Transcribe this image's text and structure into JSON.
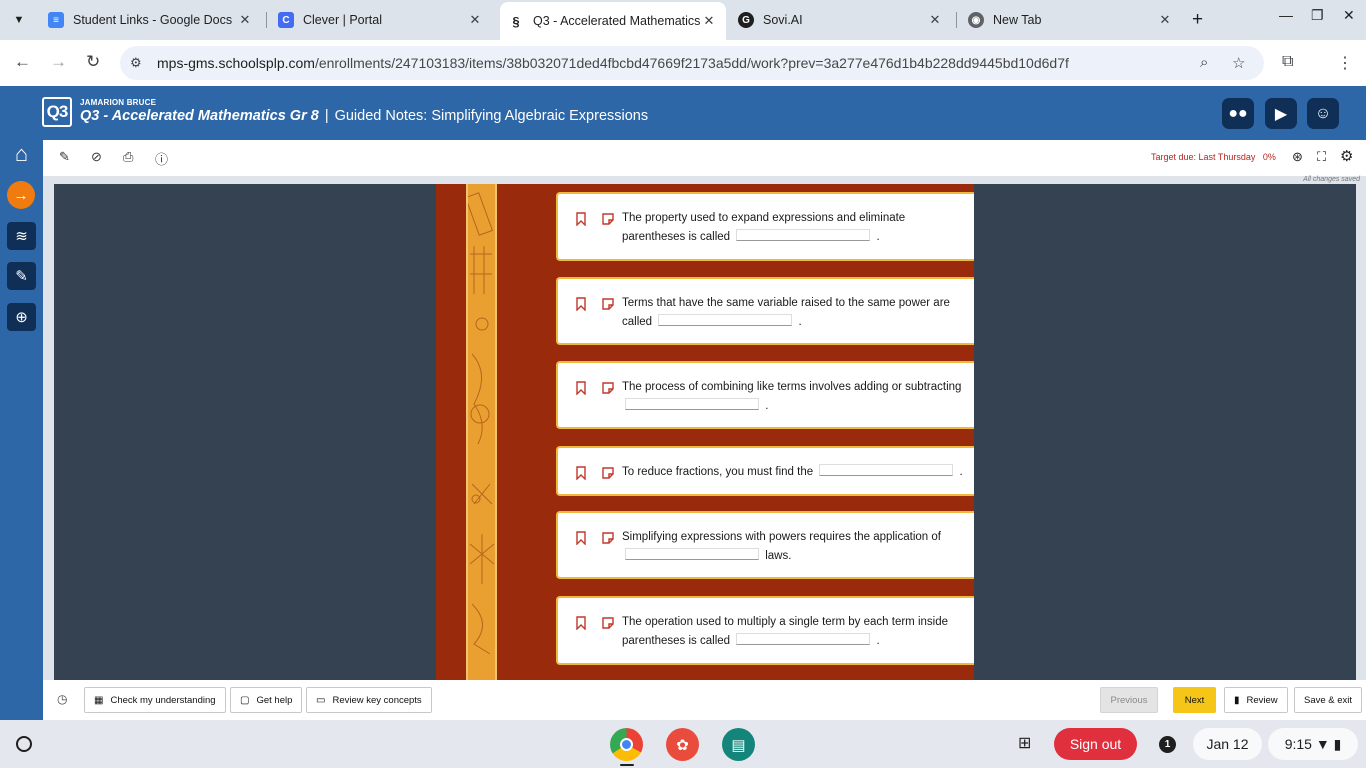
{
  "browser": {
    "tabs": [
      {
        "title": "Student Links - Google Docs",
        "icon": "google-docs-icon",
        "color": "#4285f4",
        "glyph": "≡"
      },
      {
        "title": "Clever | Portal",
        "icon": "clever-icon",
        "color": "#436cf2",
        "glyph": "C"
      },
      {
        "title": "Q3 - Accelerated Mathematics",
        "icon": "edgenuity-icon",
        "color": "#1f1f1f",
        "glyph": "S"
      },
      {
        "title": "Sovi.AI",
        "icon": "sovi-icon",
        "color": "#1f1f1f",
        "glyph": "G"
      },
      {
        "title": "New Tab",
        "icon": "chrome-icon",
        "color": "#5f6368",
        "glyph": "◉"
      }
    ],
    "url_host": "mps-gms.schoolsplp.com",
    "url_path": "/enrollments/247103183/items/38b032071ded4fbcbd47669f2173a5dd/work?prev=3a277e476d1b4b228dd9445bd10d6d7f"
  },
  "header": {
    "logo": "Q3",
    "student": "JAMARION BRUCE",
    "course": "Q3 - Accelerated Mathematics Gr 8",
    "divider": "|",
    "lesson": "Guided Notes: Simplifying Algebraic Expressions"
  },
  "toolbar": {
    "target_due": "Target due: Last Thursday",
    "progress": "0%",
    "saved": "All changes saved"
  },
  "questions": [
    {
      "before": "The property used to expand expressions and eliminate parentheses is called",
      "after": "."
    },
    {
      "before": "Terms that have the same variable raised to the same power are called",
      "after": "."
    },
    {
      "before": "The process of combining like terms involves adding or subtracting",
      "after": "."
    },
    {
      "before": "To reduce fractions, you must find the",
      "after": "."
    },
    {
      "before": "Simplifying expressions with powers requires the application of",
      "after": "laws."
    },
    {
      "before": "The operation used to multiply a single term by each term inside parentheses is called",
      "after": "."
    }
  ],
  "bottom": {
    "check": "Check my understanding",
    "help": "Get help",
    "review_concepts": "Review key concepts",
    "previous": "Previous",
    "next": "Next",
    "review": "Review",
    "save_exit": "Save & exit"
  },
  "shelf": {
    "sign_out": "Sign out",
    "notifications": "1",
    "date": "Jan 12",
    "time": "9:15"
  },
  "colors": {
    "header_blue": "#2d67a7",
    "panel_red": "#9a2a0c",
    "accent_orange": "#f07c10",
    "next_yellow": "#f5c518",
    "sign_out_red": "#e0303e"
  }
}
